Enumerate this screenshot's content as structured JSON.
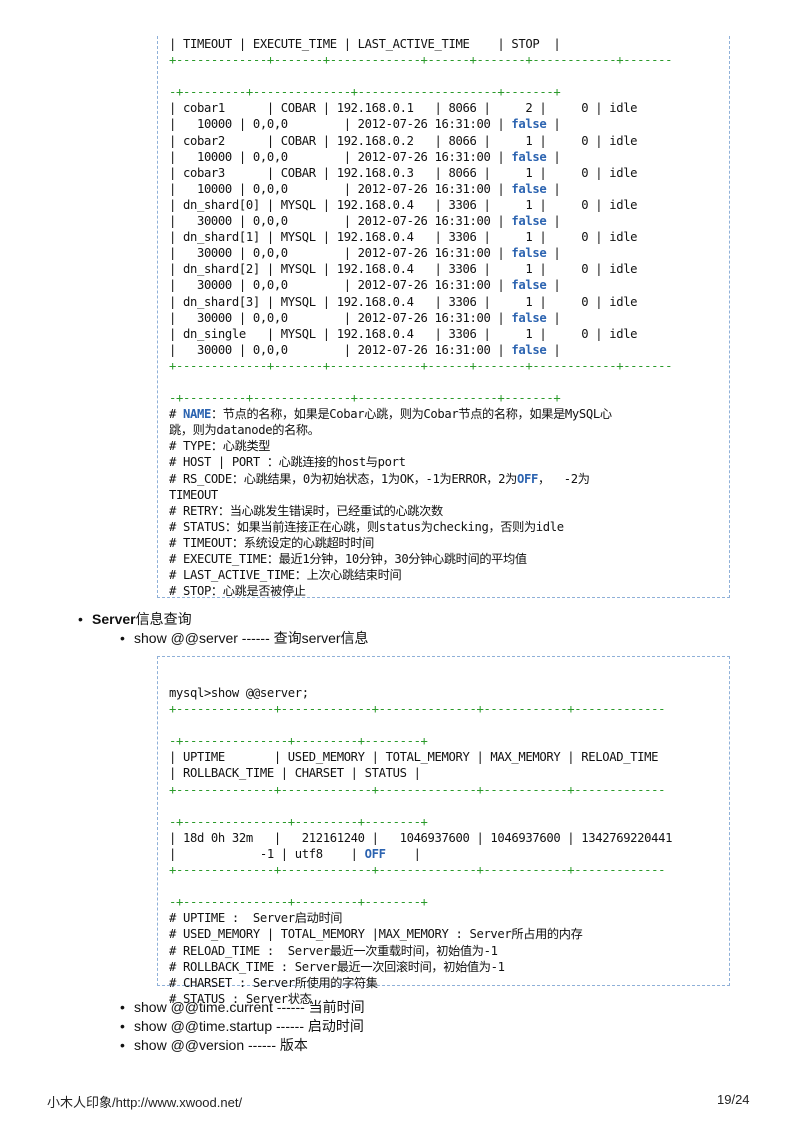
{
  "heartbeat_block": {
    "header_tail": "| TIMEOUT | EXECUTE_TIME | LAST_ACTIVE_TIME    | STOP  |",
    "sep1a": "+-------------+-------+-------------+------+-------+------------+-------",
    "sep1b": "-+---------+--------------+--------------------+-------+",
    "rows": [
      {
        "l1": "| cobar1      | COBAR | 192.168.0.1   | 8066 |     2 |     0 | idle",
        "l2a": "|   10000 | 0,0,0        | 2012-07-26 16:31:00 | ",
        "stop": "false",
        "l2b": " |"
      },
      {
        "l1": "| cobar2      | COBAR | 192.168.0.2   | 8066 |     1 |     0 | idle",
        "l2a": "|   10000 | 0,0,0        | 2012-07-26 16:31:00 | ",
        "stop": "false",
        "l2b": " |"
      },
      {
        "l1": "| cobar3      | COBAR | 192.168.0.3   | 8066 |     1 |     0 | idle",
        "l2a": "|   10000 | 0,0,0        | 2012-07-26 16:31:00 | ",
        "stop": "false",
        "l2b": " |"
      },
      {
        "l1": "| dn_shard[0] | MYSQL | 192.168.0.4   | 3306 |     1 |     0 | idle",
        "l2a": "|   30000 | 0,0,0        | 2012-07-26 16:31:00 | ",
        "stop": "false",
        "l2b": " |"
      },
      {
        "l1": "| dn_shard[1] | MYSQL | 192.168.0.4   | 3306 |     1 |     0 | idle",
        "l2a": "|   30000 | 0,0,0        | 2012-07-26 16:31:00 | ",
        "stop": "false",
        "l2b": " |"
      },
      {
        "l1": "| dn_shard[2] | MYSQL | 192.168.0.4   | 3306 |     1 |     0 | idle",
        "l2a": "|   30000 | 0,0,0        | 2012-07-26 16:31:00 | ",
        "stop": "false",
        "l2b": " |"
      },
      {
        "l1": "| dn_shard[3] | MYSQL | 192.168.0.4   | 3306 |     1 |     0 | idle",
        "l2a": "|   30000 | 0,0,0        | 2012-07-26 16:31:00 | ",
        "stop": "false",
        "l2b": " |"
      },
      {
        "l1": "| dn_single   | MYSQL | 192.168.0.4   | 3306 |     1 |     0 | idle",
        "l2a": "|   30000 | 0,0,0        | 2012-07-26 16:31:00 | ",
        "stop": "false",
        "l2b": " |"
      }
    ],
    "comments": {
      "name_prefix": "# ",
      "name_kw": "NAME",
      "name_rest": "：节点的名称，如果是Cobar心跳，则为Cobar节点的名称，如果是MySQL心",
      "name_cont": "跳，则为datanode的名称。",
      "type": "# TYPE：心跳类型",
      "host": "# HOST | PORT ：心跳连接的host与port",
      "rs_a": "# RS_CODE：心跳结果，0为初始状态，1为OK，-1为ERROR，2为",
      "rs_kw": "OFF",
      "rs_b": "，  -2为",
      "rs_cont": "TIMEOUT",
      "retry": "# RETRY：当心跳发生错误时，已经重试的心跳次数",
      "status": "# STATUS：如果当前连接正在心跳，则status为checking，否则为idle",
      "timeout": "# TIMEOUT：系统设定的心跳超时时间",
      "execute": "# EXECUTE_TIME：最近1分钟，10分钟，30分钟心跳时间的平均值",
      "last": "# LAST_ACTIVE_TIME：上次心跳结束时间",
      "stop": "# STOP：心跳是否被停止"
    }
  },
  "section": {
    "title_bold": "Server",
    "title_rest": "信息查询",
    "item": "show @@server ------ 查询server信息"
  },
  "server_block": {
    "command": "mysql>show @@server;",
    "sep_a": "+--------------+-------------+--------------+------------+-------------",
    "sep_b": "-+---------------+---------+--------+",
    "header1": "| UPTIME       | USED_MEMORY | TOTAL_MEMORY | MAX_MEMORY | RELOAD_TIME",
    "header2": "| ROLLBACK_TIME | CHARSET | STATUS |",
    "row1": "| 18d 0h 32m   |   212161240 |   1046937600 | 1046937600 | 1342769220441",
    "row2a": "|            -1 | utf8    | ",
    "row2_kw": "OFF",
    "row2b": "    |",
    "comments": [
      "# UPTIME :  Server启动时间",
      "# USED_MEMORY | TOTAL_MEMORY |MAX_MEMORY : Server所占用的内存",
      "# RELOAD_TIME :  Server最近一次重载时间，初始值为-1",
      "# ROLLBACK_TIME : Server最近一次回滚时间，初始值为-1",
      "# CHARSET : Server所使用的字符集",
      "# STATUS : Server状态"
    ]
  },
  "more_items": [
    "show @@time.current ------ 当前时间",
    "show @@time.startup ------ 启动时间",
    "show @@version ------ 版本"
  ],
  "footer": {
    "left": "小木人印象/http://www.xwood.net/",
    "page": "19/24"
  }
}
